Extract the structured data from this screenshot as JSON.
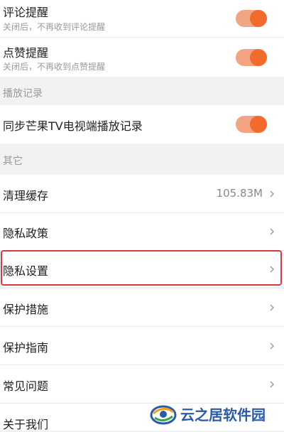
{
  "notifications": [
    {
      "title": "评论提醒",
      "subtitle": "关闭后，不再收到评论提醒",
      "enabled": true
    },
    {
      "title": "点赞提醒",
      "subtitle": "关闭后，不再收到点赞提醒",
      "enabled": true
    }
  ],
  "sections": {
    "playback": "播放记录",
    "other": "其它"
  },
  "sync": {
    "title": "同步芒果TV电视端播放记录",
    "enabled": true
  },
  "menu": {
    "clear_cache": {
      "label": "清理缓存",
      "value": "105.83M"
    },
    "privacy_policy": "隐私政策",
    "privacy_settings": "隐私设置",
    "protection_measures": "保护措施",
    "protection_guide": "保护指南",
    "faq": "常见问题",
    "about_us": "关于我们"
  },
  "colors": {
    "accent": "#f26a2c",
    "highlight": "#d63a3a"
  },
  "watermark": {
    "text": "云之居软件园"
  }
}
